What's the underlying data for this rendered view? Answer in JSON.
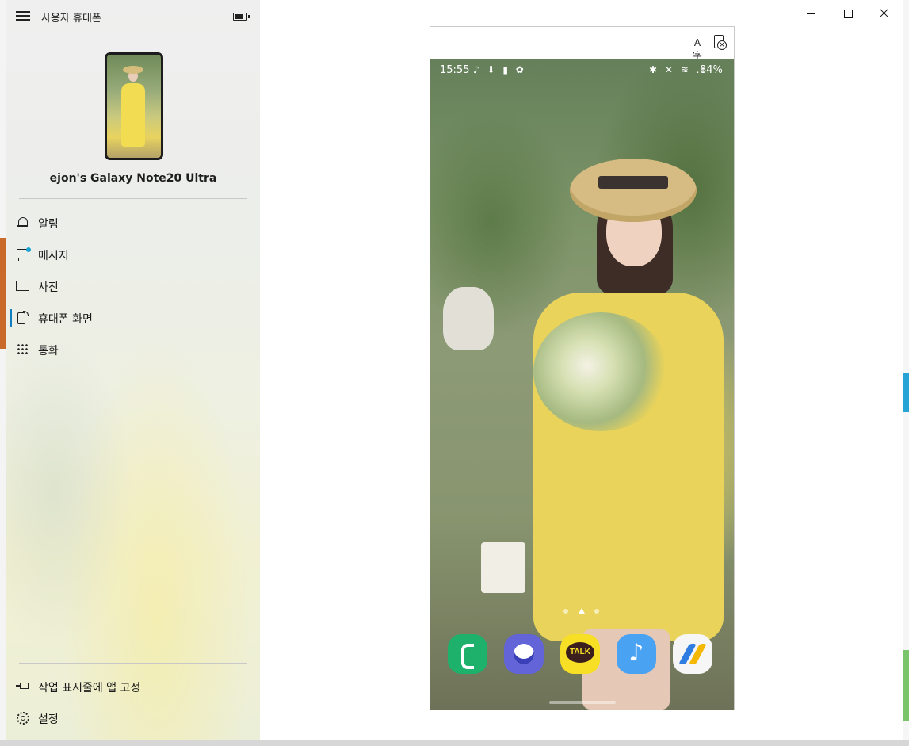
{
  "app": {
    "title": "사용자 휴대폰",
    "device_name": "ejon's Galaxy Note20 Ultra"
  },
  "nav": {
    "items": [
      {
        "label": "알림",
        "icon": "bell-icon"
      },
      {
        "label": "메시지",
        "icon": "message-icon",
        "badge_color": "#19a3d1"
      },
      {
        "label": "사진",
        "icon": "photo-icon"
      },
      {
        "label": "휴대폰 화면",
        "icon": "phone-screen-icon",
        "active": true
      },
      {
        "label": "통화",
        "icon": "dialpad-icon"
      }
    ],
    "footer": [
      {
        "label": "작업 표시줄에 앱 고정",
        "icon": "pin-icon"
      },
      {
        "label": "설정",
        "icon": "gear-icon"
      }
    ]
  },
  "window_controls": [
    "minimize-icon",
    "maximize-icon",
    "close-icon"
  ],
  "screen_toolbar": {
    "translate_glyph": "A字",
    "icons": [
      "translate-icon",
      "disconnect-phone-icon"
    ]
  },
  "phone": {
    "status_bar": {
      "time": "15:55",
      "left_icons": "♪ ⬇ ▮ ✿",
      "right_icons": "✱ ✕ ≋ .ıl",
      "battery": "84%"
    },
    "page_count": 3,
    "current_page": 2,
    "dock": [
      {
        "name": "phone-app",
        "color": "#1db16c"
      },
      {
        "name": "samsung-internet-app",
        "color": "#6264d8"
      },
      {
        "name": "kakaotalk-app",
        "color": "#f7df25",
        "label": "TALK"
      },
      {
        "name": "music-app",
        "color": "#4aa2f2"
      },
      {
        "name": "google-ads-app",
        "color": "#f6f6f6"
      }
    ]
  },
  "colors": {
    "accent": "#0f7fbf",
    "badge": "#19a3d1"
  }
}
